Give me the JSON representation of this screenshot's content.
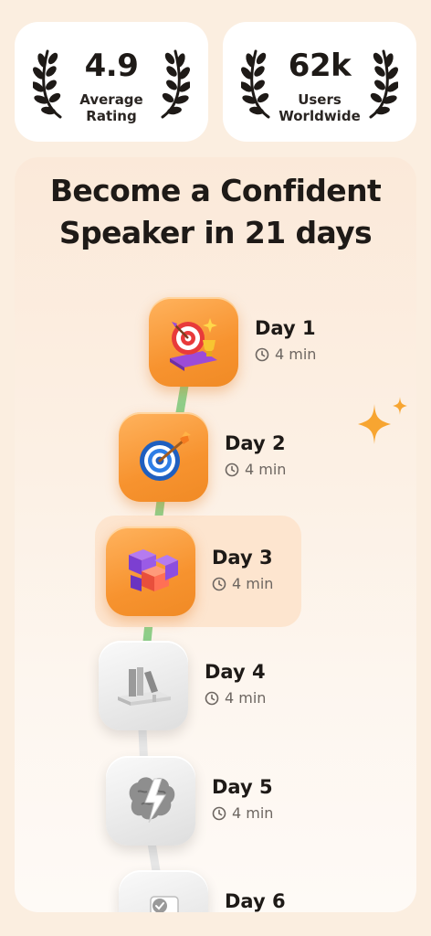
{
  "stats": [
    {
      "value": "4.9",
      "label_line1": "Average",
      "label_line2": "Rating"
    },
    {
      "value": "62k",
      "label_line1": "Users",
      "label_line2": "Worldwide"
    }
  ],
  "plan": {
    "title_line1": "Become a Confident",
    "title_line2": "Speaker in 21 days",
    "days": [
      {
        "name": "Day 1",
        "duration": "4 min",
        "status": "completed",
        "icon": "target-trophy-icon"
      },
      {
        "name": "Day 2",
        "duration": "4 min",
        "status": "completed",
        "icon": "dartboard-icon"
      },
      {
        "name": "Day 3",
        "duration": "4 min",
        "status": "current",
        "icon": "cubes-icon"
      },
      {
        "name": "Day 4",
        "duration": "4 min",
        "status": "locked",
        "icon": "books-shelf-icon"
      },
      {
        "name": "Day 5",
        "duration": "4 min",
        "status": "locked",
        "icon": "brain-lightning-icon"
      },
      {
        "name": "Day 6",
        "duration": "",
        "status": "locked",
        "icon": "checkbox-icon"
      }
    ]
  },
  "colors": {
    "background": "#fbeee0",
    "completed_tile": "#f7932f",
    "locked_tile": "#e9e9e9",
    "progress_line": "#8fcf8a",
    "locked_line": "#e6e6e6",
    "current_highlight": "#fde5cf",
    "sparkle": "#f7a531"
  }
}
